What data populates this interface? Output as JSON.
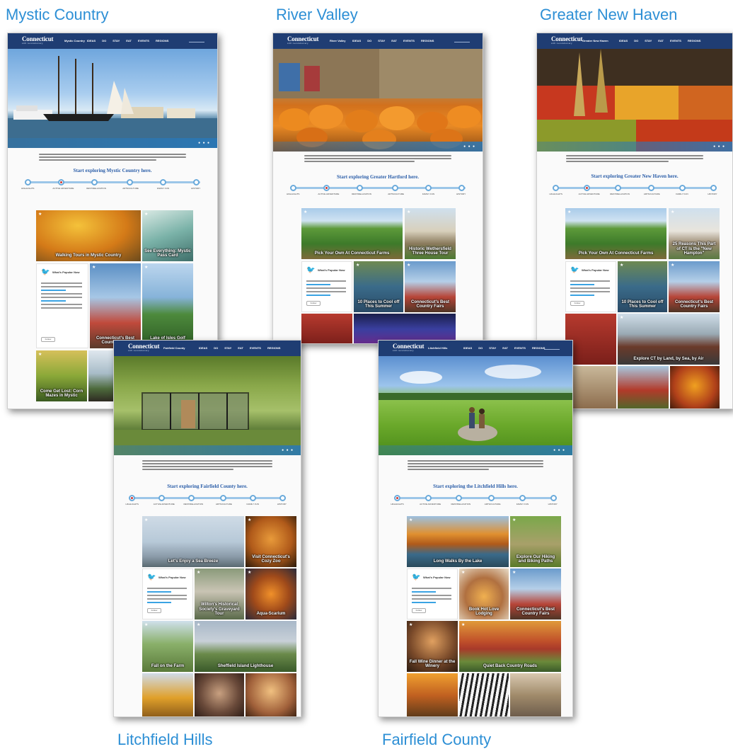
{
  "captions": {
    "mystic": "Mystic Country",
    "river": "River Valley",
    "haven": "Greater New Haven",
    "litch": "Litchfield Hills",
    "fair": "Fairfield County"
  },
  "nav": {
    "logo": "Connecticut",
    "tagline": "still revolutionary",
    "menu": [
      "IDEAS",
      "DO",
      "STAY",
      "EAT",
      "EVENTS",
      "REGIONS"
    ]
  },
  "timeline_labels": [
    "HIGHLIGHTS",
    "ACTIVE ADVENTURE",
    "REST/RELAXATION",
    "ARTS/CULTURE",
    "FAMILY FUN",
    "HISTORY"
  ],
  "mystic": {
    "region": "Mystic Country",
    "explore": "Start exploring Mystic Country here.",
    "tiles": [
      "Walking Tours in Mystic Country",
      "See Everything: Mystic Pass Card",
      "Connecticut's Best Country Fairs",
      "Lake of Isles Golf Course",
      "Come Get Lost: Corn Mazes in Mystic"
    ],
    "twitter": "What's Popular Now"
  },
  "river": {
    "region": "River Valley",
    "explore": "Start exploring Greater Hartford here.",
    "tiles": [
      "Pick Your Own At Connecticut Farms",
      "Historic Wethersfield Three House Tour",
      "10 Places to Cool off This Summer",
      "Connecticut's Best Country Fairs"
    ],
    "twitter": "What's Popular Now"
  },
  "haven": {
    "region": "Greater New Haven",
    "explore": "Start exploring Greater New Haven here.",
    "tiles": [
      "Pick Your Own At Connecticut Farms",
      "25 Reasons This Part of CT Is the \"New Hampton\"",
      "10 Places to Cool off This Summer",
      "Connecticut's Best Country Fairs",
      "Explore CT by Land, by Sea, by Air"
    ],
    "twitter": "What's Popular Now"
  },
  "fairfield_shot": {
    "region": "Fairfield County",
    "explore": "Start exploring Fairfield County here.",
    "tiles": [
      "Let's Enjoy a Sea Breeze",
      "Visit Connecticut's Cozy Zoo",
      "Wilton's Historical Society's Graveyard Tour",
      "Aqua-Scarium",
      "Fall on the Farm",
      "Sheffield Island Lighthouse"
    ],
    "twitter": "What's Popular Now"
  },
  "litch_shot": {
    "region": "Litchfield Hills",
    "explore": "Start exploring the Litchfield Hills here.",
    "tiles": [
      "Long Walks By the Lake",
      "Explore Our Hiking and Biking Paths",
      "Book Hot Love Lodging",
      "Connecticut's Best Country Fairs",
      "Fall Wine Dinner at the Winery",
      "Quiet Back Country Roads"
    ],
    "twitter": "What's Popular Now"
  }
}
